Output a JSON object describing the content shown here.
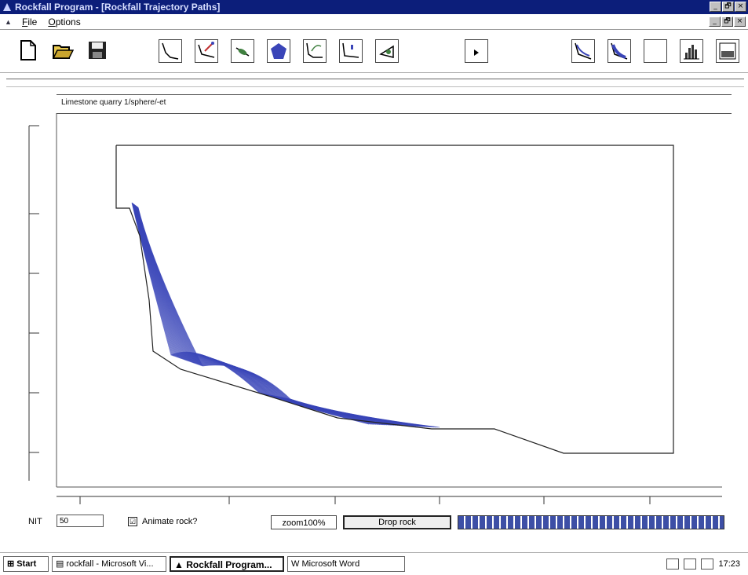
{
  "window": {
    "title": "Rockfall Program - [Rockfall Trajectory Paths]",
    "controls": [
      "_",
      "🗗",
      "×"
    ]
  },
  "menubar": {
    "items": [
      "File",
      "Options"
    ]
  },
  "toolbar": {
    "buttons": [
      {
        "name": "new-file-icon"
      },
      {
        "name": "open-folder-icon"
      },
      {
        "name": "save-icon"
      },
      {
        "name": "slope-profile-icon"
      },
      {
        "name": "slope-edit-icon"
      },
      {
        "name": "rock-icon"
      },
      {
        "name": "shape-pentagon-icon"
      },
      {
        "name": "trajectory-icon"
      },
      {
        "name": "barrier-icon"
      },
      {
        "name": "angle-icon"
      },
      {
        "name": "play-icon"
      },
      {
        "name": "paths-icon"
      },
      {
        "name": "paths-filled-icon"
      },
      {
        "name": "blank-icon"
      },
      {
        "name": "histogram-icon"
      },
      {
        "name": "report-icon"
      }
    ]
  },
  "plot": {
    "subtitle": "Limestone quarry 1/sphere/-et"
  },
  "chart_data": {
    "type": "line",
    "title": "Limestone quarry 1/sphere/-et",
    "slope_profile": [
      [
        148,
        185
      ],
      [
        858,
        185
      ],
      [
        858,
        577
      ],
      [
        718,
        577
      ],
      [
        630,
        546
      ],
      [
        550,
        546
      ],
      [
        430,
        532
      ],
      [
        345,
        505
      ],
      [
        230,
        470
      ],
      [
        195,
        447
      ],
      [
        190,
        382
      ],
      [
        178,
        300
      ],
      [
        165,
        265
      ],
      [
        148,
        265
      ],
      [
        148,
        185
      ]
    ],
    "trajectory_count": 40,
    "series_color": "#3a45b8",
    "profile_color": "#222222",
    "xlim": [
      0,
      10
    ],
    "ylim": [
      0,
      10
    ]
  },
  "controls": {
    "nit_label": "NIT",
    "nit_value": "50",
    "animate_label": "Animate rock?",
    "animate_checked": "☑",
    "zoom_label": "zoom100%",
    "drop_label": "Drop rock",
    "progress": 1.0
  },
  "taskbar": {
    "start_label": "Start",
    "tasks": [
      "rockfall - Microsoft Vi...",
      "Rockfall Program...",
      "Microsoft Word"
    ],
    "clock": "17:23"
  }
}
